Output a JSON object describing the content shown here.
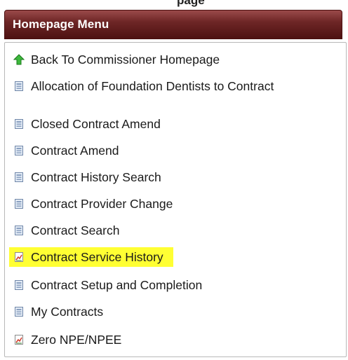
{
  "page_heading_fragment": "page",
  "menu": {
    "title": "Homepage Menu",
    "items": [
      {
        "label": "Back To Commissioner Homepage",
        "icon": "up-arrow-icon"
      },
      {
        "label": "Allocation of Foundation Dentists to Contract",
        "icon": "form-icon"
      },
      {
        "label": "Closed Contract Amend",
        "icon": "form-icon"
      },
      {
        "label": "Contract Amend",
        "icon": "form-icon"
      },
      {
        "label": "Contract History Search",
        "icon": "form-icon"
      },
      {
        "label": "Contract Provider Change",
        "icon": "form-icon"
      },
      {
        "label": "Contract Search",
        "icon": "form-icon"
      },
      {
        "label": "Contract Service History",
        "icon": "report-icon",
        "highlighted": true
      },
      {
        "label": "Contract Setup and Completion",
        "icon": "form-icon"
      },
      {
        "label": "My Contracts",
        "icon": "form-icon"
      },
      {
        "label": "Zero NPE/NPEE",
        "icon": "report-icon"
      }
    ]
  },
  "colors": {
    "header_bg": "#6e2626",
    "highlight": "#ffff33",
    "arrow_green": "#2ea82e"
  }
}
